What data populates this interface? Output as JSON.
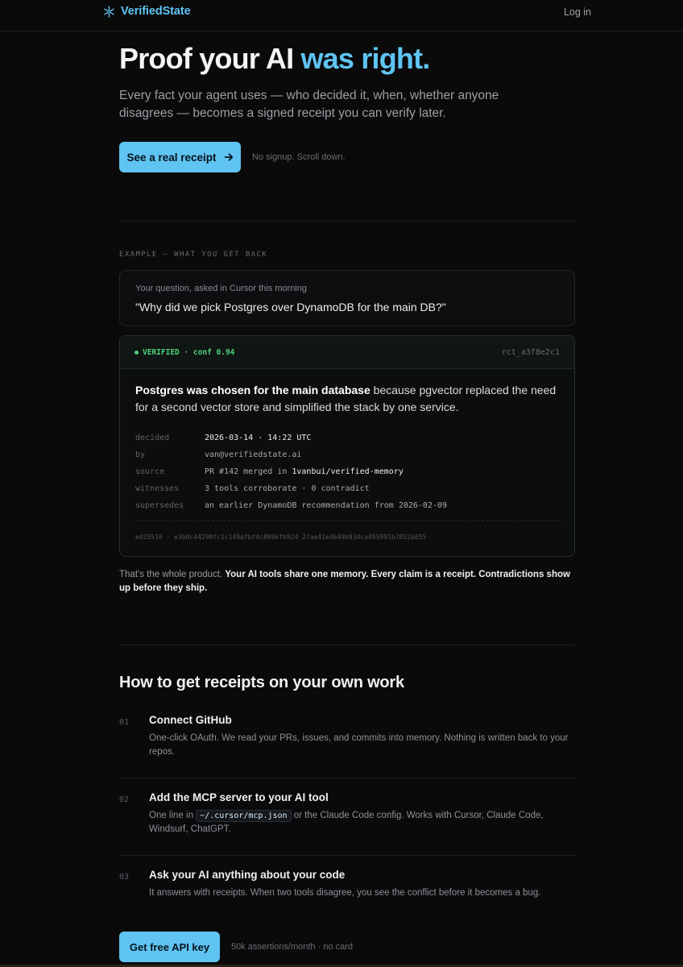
{
  "nav": {
    "brand": "VerifiedState",
    "brand_icon": "asterisk-sparkle-icon",
    "login": "Log in"
  },
  "hero": {
    "title_main": "Proof your AI",
    "title_accent": "was right.",
    "subtitle": "Every fact your agent uses — who decided it, when, whether anyone disagrees — becomes a signed receipt you can verify later.",
    "cta_label": "See a real receipt",
    "cta_icon": "arrow-right-icon",
    "cta_note": "No signup. Scroll down."
  },
  "example": {
    "eyebrow": "EXAMPLE — WHAT YOU GET BACK",
    "question_label": "Your question, asked in Cursor this morning",
    "question_text": "\"Why did we pick Postgres over DynamoDB for the main DB?\"",
    "receipt": {
      "status": "VERIFIED · conf 0.94",
      "id": "rct_a3f8e2c1",
      "claim_bold": "Postgres was chosen for the main database",
      "claim_rest": " because pgvector replaced the need for a second vector store and simplified the stack by one service.",
      "fields": [
        {
          "key": "decided",
          "value": "2026-03-14 · 14:22 UTC"
        },
        {
          "key": "by",
          "value": "van@verifiedstate.ai"
        },
        {
          "key": "source",
          "value_prefix": "PR #142 merged in ",
          "value_highlight": "1vanbui/verified-memory"
        },
        {
          "key": "witnesses",
          "value": "3 tools corroborate · 0 contradict"
        },
        {
          "key": "supersedes",
          "value": "an earlier DynamoDB recommendation from 2026-02-09"
        }
      ],
      "signature": "ed25519 · e3b0c44298fc1c149afbf4c8996fb924 27ae41e4649b934ca495991b7852b855"
    },
    "summary_plain": "That's the whole product. ",
    "summary_bold": "Your AI tools share one memory. Every claim is a receipt. Contradictions show up before they ship."
  },
  "how": {
    "title": "How to get receipts on your own work",
    "steps": [
      {
        "num": "01",
        "title": "Connect GitHub",
        "desc": "One-click OAuth. We read your PRs, issues, and commits into memory. Nothing is written back to your repos."
      },
      {
        "num": "02",
        "title": "Add the MCP server to your AI tool",
        "desc_prefix": "One line in ",
        "desc_code": "~/.cursor/mcp.json",
        "desc_suffix": " or the Claude Code config. Works with Cursor, Claude Code, Windsurf, ChatGPT."
      },
      {
        "num": "03",
        "title": "Ask your AI anything about your code",
        "desc": "It answers with receipts. When two tools disagree, you see the conflict before it becomes a bug."
      }
    ],
    "cta_label": "Get free API key",
    "cta_note": "50k assertions/month · no card"
  },
  "colors": {
    "accent": "#5fc4f2",
    "verified": "#4fd17c",
    "background": "#0a0a0b"
  }
}
